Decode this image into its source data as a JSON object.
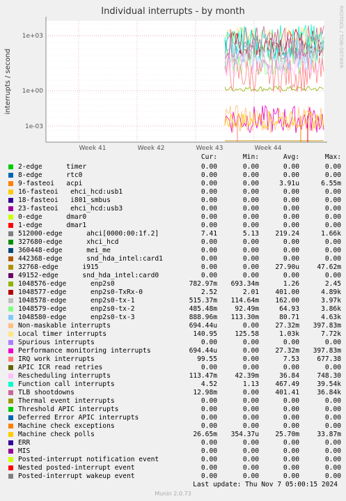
{
  "chart_data": {
    "type": "line",
    "title": "Individual interrupts - by month",
    "ylabel": "interrupts / second",
    "side_label": "RRDTOOL / TOBI OETIKER",
    "y_scale": "log",
    "y_ticks": [
      "1e+03",
      "1e+00",
      "1e-03"
    ],
    "x_ticks": [
      "Week 41",
      "Week 42",
      "Week 43",
      "Week 44"
    ],
    "grid": true,
    "columns": [
      "Cur:",
      "Min:",
      "Avg:",
      "Max:"
    ],
    "series": [
      {
        "label": "2-edge      timer",
        "color": "#00cc00",
        "cur": "0.00",
        "min": "0.00",
        "avg": "0.00",
        "max": "0.00"
      },
      {
        "label": "8-edge      rtc0",
        "color": "#0066b3",
        "cur": "0.00",
        "min": "0.00",
        "avg": "0.00",
        "max": "0.00"
      },
      {
        "label": "9-fasteoi   acpi",
        "color": "#ff8000",
        "cur": "0.00",
        "min": "0.00",
        "avg": "3.91u",
        "max": "6.55m"
      },
      {
        "label": "16-fasteoi   ehci_hcd:usb1",
        "color": "#ffcc00",
        "cur": "0.00",
        "min": "0.00",
        "avg": "0.00",
        "max": "0.00"
      },
      {
        "label": "18-fasteoi   i801_smbus",
        "color": "#330099",
        "cur": "0.00",
        "min": "0.00",
        "avg": "0.00",
        "max": "0.00"
      },
      {
        "label": "23-fasteoi   ehci_hcd:usb3",
        "color": "#990099",
        "cur": "0.00",
        "min": "0.00",
        "avg": "0.00",
        "max": "0.00"
      },
      {
        "label": "0-edge      dmar0",
        "color": "#ccff00",
        "cur": "0.00",
        "min": "0.00",
        "avg": "0.00",
        "max": "0.00"
      },
      {
        "label": "1-edge      dmar1",
        "color": "#ff0000",
        "cur": "0.00",
        "min": "0.00",
        "avg": "0.00",
        "max": "0.00"
      },
      {
        "label": "512000-edge      ahci[0000:00:1f.2]",
        "color": "#808080",
        "cur": "7.41",
        "min": "5.13",
        "avg": "219.24",
        "max": "1.66k"
      },
      {
        "label": "327680-edge      xhci_hcd",
        "color": "#008f00",
        "cur": "0.00",
        "min": "0.00",
        "avg": "0.00",
        "max": "0.00"
      },
      {
        "label": "360448-edge      mei_me",
        "color": "#00487d",
        "cur": "0.00",
        "min": "0.00",
        "avg": "0.00",
        "max": "0.00"
      },
      {
        "label": "442368-edge      snd_hda_intel:card1",
        "color": "#b35a00",
        "cur": "0.00",
        "min": "0.00",
        "avg": "0.00",
        "max": "0.00"
      },
      {
        "label": "32768-edge      i915",
        "color": "#b38f00",
        "cur": "0.00",
        "min": "0.00",
        "avg": "27.90u",
        "max": "47.62m"
      },
      {
        "label": "49152-edge      snd_hda_intel:card0",
        "color": "#6b006b",
        "cur": "0.00",
        "min": "0.00",
        "avg": "0.00",
        "max": "0.00"
      },
      {
        "label": "1048576-edge      enp2s0",
        "color": "#8fb300",
        "cur": "782.97m",
        "min": "693.34m",
        "avg": "1.26",
        "max": "2.45"
      },
      {
        "label": "1048577-edge      enp2s0-TxRx-0",
        "color": "#b30000",
        "cur": "2.52",
        "min": "2.01",
        "avg": "401.00",
        "max": "4.89k"
      },
      {
        "label": "1048578-edge      enp2s0-tx-1",
        "color": "#bebebe",
        "cur": "515.37m",
        "min": "114.64m",
        "avg": "162.00",
        "max": "3.97k"
      },
      {
        "label": "1048579-edge      enp2s0-tx-2",
        "color": "#80ff80",
        "cur": "485.48m",
        "min": "92.49m",
        "avg": "64.93",
        "max": "3.86k"
      },
      {
        "label": "1048580-edge      enp2s0-tx-3",
        "color": "#80c9ff",
        "cur": "888.96m",
        "min": "113.30m",
        "avg": "80.71",
        "max": "4.63k"
      },
      {
        "label": "Non-maskable interrupts",
        "color": "#ffc080",
        "cur": "694.44u",
        "min": "0.00",
        "avg": "27.32m",
        "max": "397.83m"
      },
      {
        "label": "Local timer interrupts",
        "color": "#ffe680",
        "cur": "140.95",
        "min": "125.58",
        "avg": "1.03k",
        "max": "7.72k"
      },
      {
        "label": "Spurious interrupts",
        "color": "#aa80ff",
        "cur": "0.00",
        "min": "0.00",
        "avg": "0.00",
        "max": "0.00"
      },
      {
        "label": "Performance monitoring interrupts",
        "color": "#ee00cc",
        "cur": "694.44u",
        "min": "0.00",
        "avg": "27.32m",
        "max": "397.83m"
      },
      {
        "label": "IRQ work interrupts",
        "color": "#ff8080",
        "cur": "99.55",
        "min": "0.00",
        "avg": "7.53",
        "max": "677.38"
      },
      {
        "label": "APIC ICR read retries",
        "color": "#666600",
        "cur": "0.00",
        "min": "0.00",
        "avg": "0.00",
        "max": "0.00"
      },
      {
        "label": "Rescheduling interrupts",
        "color": "#ffbfff",
        "cur": "113.47m",
        "min": "42.39m",
        "avg": "36.84",
        "max": "748.30"
      },
      {
        "label": "Function call interrupts",
        "color": "#00ffcc",
        "cur": "4.52",
        "min": "1.13",
        "avg": "467.49",
        "max": "39.54k"
      },
      {
        "label": "TLB shootdowns",
        "color": "#cc6699",
        "cur": "12.98m",
        "min": "0.00",
        "avg": "401.41",
        "max": "36.84k"
      },
      {
        "label": "Thermal event interrupts",
        "color": "#999900",
        "cur": "0.00",
        "min": "0.00",
        "avg": "0.00",
        "max": "0.00"
      },
      {
        "label": "Threshold APIC interrupts",
        "color": "#00cc00",
        "cur": "0.00",
        "min": "0.00",
        "avg": "0.00",
        "max": "0.00"
      },
      {
        "label": "Deferred Error APIC interrupts",
        "color": "#0066b3",
        "cur": "0.00",
        "min": "0.00",
        "avg": "0.00",
        "max": "0.00"
      },
      {
        "label": "Machine check exceptions",
        "color": "#ff8000",
        "cur": "0.00",
        "min": "0.00",
        "avg": "0.00",
        "max": "0.00"
      },
      {
        "label": "Machine check polls",
        "color": "#ffcc00",
        "cur": "26.65m",
        "min": "354.37u",
        "avg": "25.70m",
        "max": "33.87m"
      },
      {
        "label": "ERR",
        "color": "#330099",
        "cur": "0.00",
        "min": "0.00",
        "avg": "0.00",
        "max": "0.00"
      },
      {
        "label": "MIS",
        "color": "#990099",
        "cur": "0.00",
        "min": "0.00",
        "avg": "0.00",
        "max": "0.00"
      },
      {
        "label": "Posted-interrupt notification event",
        "color": "#ccff00",
        "cur": "0.00",
        "min": "0.00",
        "avg": "0.00",
        "max": "0.00"
      },
      {
        "label": "Nested posted-interrupt event",
        "color": "#ff0000",
        "cur": "0.00",
        "min": "0.00",
        "avg": "0.00",
        "max": "0.00"
      },
      {
        "label": "Posted-interrupt wakeup event",
        "color": "#808080",
        "cur": "0.00",
        "min": "0.00",
        "avg": "0.00",
        "max": "0.00"
      }
    ]
  },
  "last_update": "Last update: Thu Nov  7 05:00:15 2024",
  "footer": "Munin 2.0.73"
}
